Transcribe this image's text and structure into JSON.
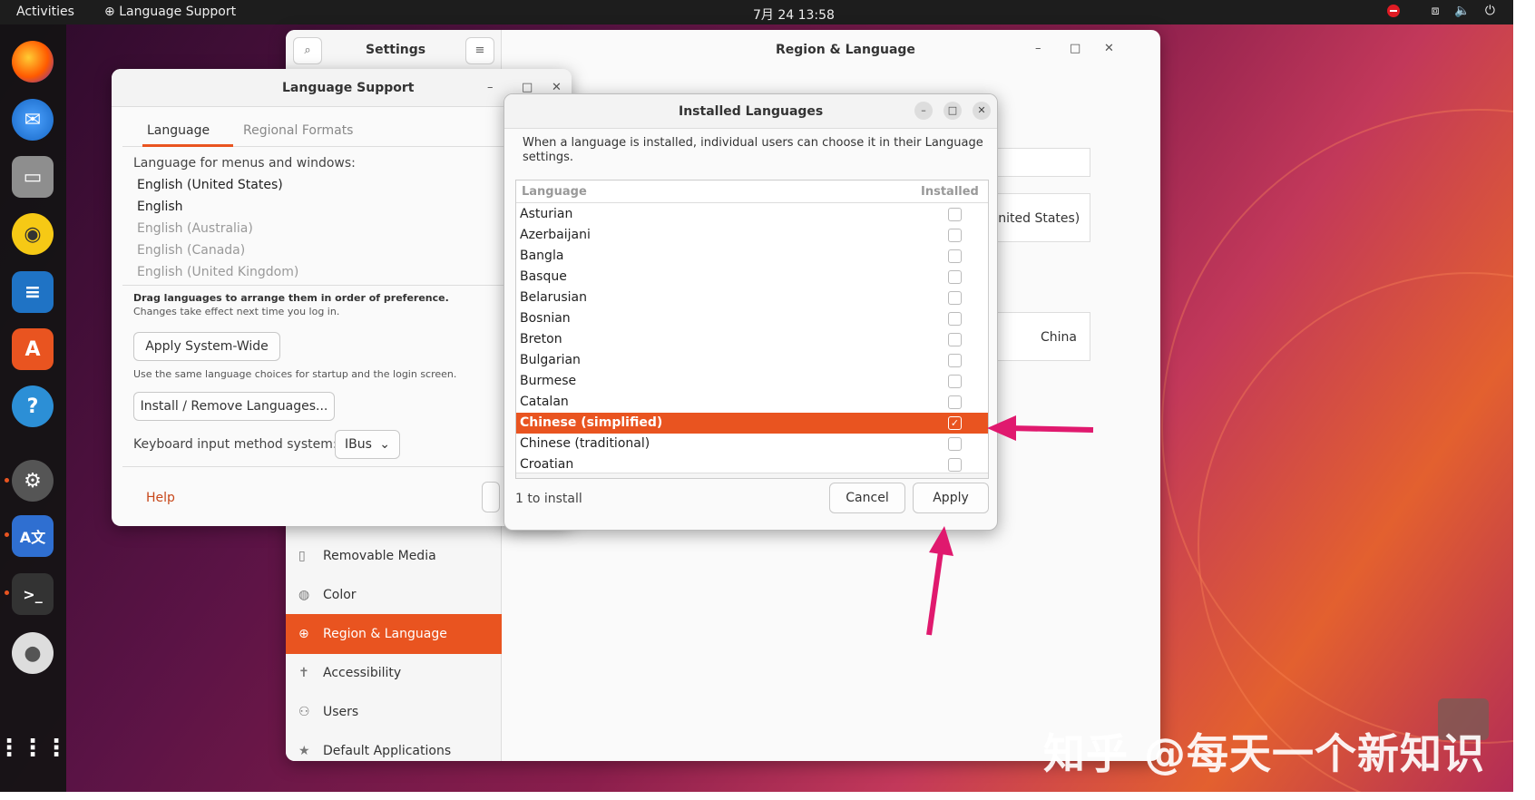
{
  "topbar": {
    "activities": "Activities",
    "app_name": "Language Support",
    "clock": "7月 24  13:58"
  },
  "settings": {
    "search_title": "Settings",
    "title": "Region & Language",
    "sidebar": [
      {
        "label": "Removable Media",
        "icon": "usb-icon"
      },
      {
        "label": "Color",
        "icon": "color-icon"
      },
      {
        "label": "Region & Language",
        "icon": "globe-icon",
        "active": true
      },
      {
        "label": "Accessibility",
        "icon": "accessibility-icon"
      },
      {
        "label": "Users",
        "icon": "users-icon"
      },
      {
        "label": "Default Applications",
        "icon": "star-icon"
      }
    ],
    "language_value": "United States)",
    "formats_value": "China"
  },
  "language_support": {
    "title": "Language Support",
    "tab_language": "Language",
    "tab_regional": "Regional Formats",
    "menus_label": "Language for menus and windows:",
    "languages": [
      "English (United States)",
      "English",
      "English (Australia)",
      "English (Canada)",
      "English (United Kingdom)"
    ],
    "drag_hint": "Drag languages to arrange them in order of preference.",
    "drag_hint2": "Changes take effect next time you log in.",
    "apply_system_wide": "Apply System-Wide",
    "apply_hint": "Use the same language choices for startup and the login screen.",
    "install_remove": "Install / Remove Languages...",
    "keyboard_label": "Keyboard input method system:",
    "keyboard_value": "IBus",
    "help": "Help"
  },
  "installed_languages": {
    "title": "Installed Languages",
    "description": "When a language is installed, individual users can choose it in their Language settings.",
    "col_language": "Language",
    "col_installed": "Installed",
    "rows": [
      {
        "name": "Asturian",
        "installed": false
      },
      {
        "name": "Azerbaijani",
        "installed": false
      },
      {
        "name": "Bangla",
        "installed": false
      },
      {
        "name": "Basque",
        "installed": false
      },
      {
        "name": "Belarusian",
        "installed": false
      },
      {
        "name": "Bosnian",
        "installed": false
      },
      {
        "name": "Breton",
        "installed": false
      },
      {
        "name": "Bulgarian",
        "installed": false
      },
      {
        "name": "Burmese",
        "installed": false
      },
      {
        "name": "Catalan",
        "installed": false
      },
      {
        "name": "Chinese (simplified)",
        "installed": true,
        "selected": true
      },
      {
        "name": "Chinese (traditional)",
        "installed": false
      },
      {
        "name": "Croatian",
        "installed": false
      }
    ],
    "status": "1 to install",
    "cancel": "Cancel",
    "apply": "Apply"
  },
  "watermark": "知乎 @每天一个新知识",
  "colors": {
    "accent": "#e95420",
    "arrow": "#e0196e"
  }
}
